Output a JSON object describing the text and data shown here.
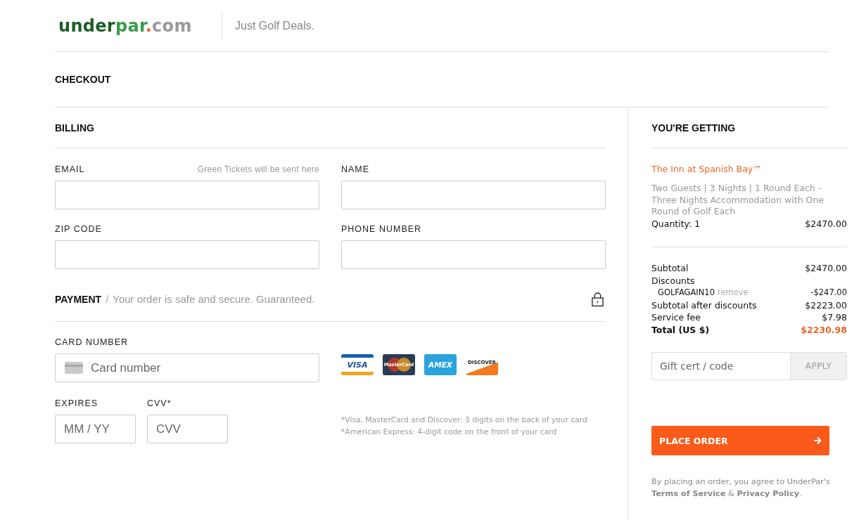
{
  "header": {
    "logo": [
      {
        "text": "under",
        "color": "#1f5d2a"
      },
      {
        "text": "par",
        "color": "#3a9a48"
      },
      {
        "text": ".",
        "color": "#e8662a"
      },
      {
        "text": "com",
        "color": "#9a9a9a"
      }
    ],
    "tagline": "Just Golf Deals."
  },
  "page_title": "CHECKOUT",
  "billing": {
    "title": "BILLING",
    "fields": [
      {
        "label": "EMAIL",
        "hint": "Green Tickets will be sent here"
      },
      {
        "label": "NAME"
      },
      {
        "label": "ZIP CODE"
      },
      {
        "label": "PHONE NUMBER"
      }
    ]
  },
  "payment": {
    "title": "PAYMENT",
    "separator": "/",
    "subtitle": "Your order is safe and secure. Guaranteed.",
    "card_number": {
      "label": "CARD NUMBER",
      "placeholder": "Card number"
    },
    "cards": [
      {
        "kind": "visa",
        "label": "VISA"
      },
      {
        "kind": "mastercard",
        "label": "MasterCard"
      },
      {
        "kind": "amex",
        "label": "AMEX"
      },
      {
        "kind": "discover",
        "label": "DISCOVER"
      }
    ],
    "expires": {
      "label": "EXPIRES",
      "placeholder": "MM / YY"
    },
    "cvv": {
      "label": "CVV*",
      "placeholder": "CVV"
    },
    "notes": [
      "*Visa, MasterCard and Discover: 3 digits on the back of your card",
      "*American Express: 4-digit code on the front of your card"
    ]
  },
  "summary": {
    "title": "YOU'RE GETTING",
    "product": "The Inn at Spanish Bay™",
    "description": "Two Guests | 3 Nights | 1 Round Each - Three Nights Accommodation with One Round of Golf Each",
    "quantity": "Quantity: 1",
    "price": "$2470.00",
    "lines": [
      {
        "kind": "plain",
        "label": "Subtotal",
        "value": "$2470.00"
      },
      {
        "kind": "heading",
        "label": "Discounts"
      },
      {
        "kind": "code",
        "label": "GOLFAGAIN10",
        "action": "remove",
        "value": "-$247.00"
      },
      {
        "kind": "plain",
        "label": "Subtotal after discounts",
        "value": "$2223.00"
      },
      {
        "kind": "plain",
        "label": "Service fee",
        "value": "$7.98"
      },
      {
        "kind": "total",
        "label": "Total (US $)",
        "value": "$2230.98"
      }
    ],
    "gift": {
      "placeholder": "Gift cert / code",
      "button": "APPLY"
    },
    "place_order": "PLACE ORDER",
    "legal": {
      "text": "By placing an order, you agree to UnderPar's",
      "links": [
        "Terms of Service",
        "Privacy Policy"
      ],
      "joiner": "&",
      "end": "."
    }
  }
}
